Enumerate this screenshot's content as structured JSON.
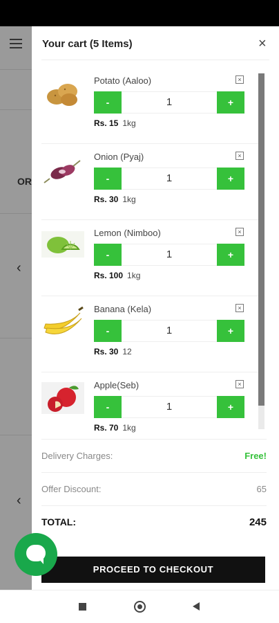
{
  "cart": {
    "title": "Your cart (5 Items)",
    "items": [
      {
        "name": "Potato (Aaloo)",
        "qty": "1",
        "price": "Rs. 15",
        "unit": "1kg",
        "icon": "potato-image"
      },
      {
        "name": "Onion (Pyaj)",
        "qty": "1",
        "price": "Rs. 30",
        "unit": "1kg",
        "icon": "onion-image"
      },
      {
        "name": "Lemon (Nimboo)",
        "qty": "1",
        "price": "Rs. 100",
        "unit": "1kg",
        "icon": "lemon-image"
      },
      {
        "name": "Banana (Kela)",
        "qty": "1",
        "price": "Rs. 30",
        "unit": "12",
        "icon": "banana-image"
      },
      {
        "name": "Apple(Seb)",
        "qty": "1",
        "price": "Rs. 70",
        "unit": "1kg",
        "icon": "apple-image"
      }
    ],
    "minus_label": "-",
    "plus_label": "+",
    "remove_glyph": "×",
    "close_glyph": "×"
  },
  "summary": {
    "delivery_label": "Delivery Charges:",
    "delivery_value": "Free!",
    "discount_label": "Offer Discount:",
    "discount_value": "65",
    "total_label": "TOTAL:",
    "total_value": "245"
  },
  "checkout": {
    "label": "PROCEED TO CHECKOUT"
  },
  "background": {
    "or_text": "OR",
    "chevron": "‹"
  },
  "colors": {
    "accent": "#36c13b",
    "chat": "#19a84b",
    "dark": "#111111"
  }
}
